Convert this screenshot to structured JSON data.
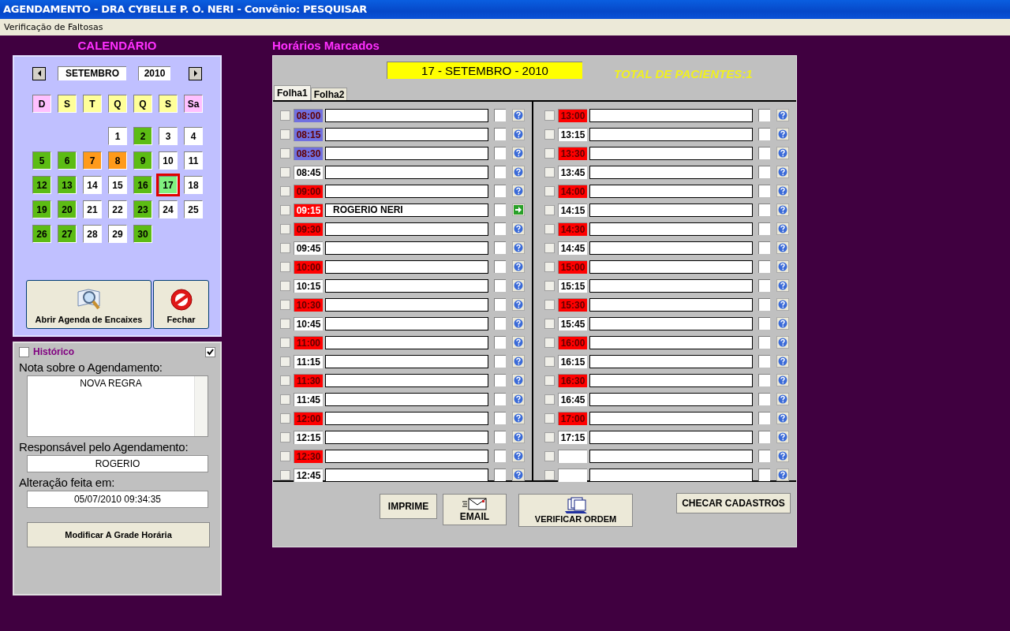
{
  "window": {
    "title": "AGENDAMENTO - DRA CYBELLE P. O. NERI - Convênio: PESQUISAR"
  },
  "menu": [
    "Verificação de Faltosas"
  ],
  "calendar": {
    "heading": "CALENDÁRIO",
    "month": "SETEMBRO",
    "year": "2010",
    "weekdays": [
      {
        "label": "D",
        "color": "#ffc0ff"
      },
      {
        "label": "S",
        "color": "#ffff99"
      },
      {
        "label": "T",
        "color": "#ffff99"
      },
      {
        "label": "Q",
        "color": "#ffff99"
      },
      {
        "label": "Q",
        "color": "#ffff99"
      },
      {
        "label": "S",
        "color": "#ffff99"
      },
      {
        "label": "Sa",
        "color": "#ffc0ff"
      }
    ],
    "weeks": [
      [
        {
          "kind": "blank"
        },
        {
          "kind": "blank"
        },
        {
          "kind": "blank"
        },
        {
          "day": "1",
          "color": "#ffffff",
          "selected": false
        },
        {
          "day": "2",
          "color": "#5cbc14",
          "selected": false
        },
        {
          "day": "3",
          "color": "#ffffff",
          "selected": false
        },
        {
          "day": "4",
          "color": "#ffffff",
          "selected": false
        }
      ],
      [
        {
          "day": "5",
          "color": "#5cbc14",
          "selected": false
        },
        {
          "day": "6",
          "color": "#5cbc14",
          "selected": false
        },
        {
          "day": "7",
          "color": "#ff9a1a",
          "selected": false
        },
        {
          "day": "8",
          "color": "#ff9a1a",
          "selected": false
        },
        {
          "day": "9",
          "color": "#5cbc14",
          "selected": false
        },
        {
          "day": "10",
          "color": "#ffffff",
          "selected": false
        },
        {
          "day": "11",
          "color": "#ffffff",
          "selected": false
        }
      ],
      [
        {
          "day": "12",
          "color": "#5cbc14",
          "selected": false
        },
        {
          "day": "13",
          "color": "#5cbc14",
          "selected": false
        },
        {
          "day": "14",
          "color": "#ffffff",
          "selected": false
        },
        {
          "day": "15",
          "color": "#ffffff",
          "selected": false
        },
        {
          "day": "16",
          "color": "#5cbc14",
          "selected": false
        },
        {
          "day": "17",
          "color": "#80f080",
          "selected": true
        },
        {
          "day": "18",
          "color": "#ffffff",
          "selected": false
        }
      ],
      [
        {
          "day": "19",
          "color": "#5cbc14",
          "selected": false
        },
        {
          "day": "20",
          "color": "#5cbc14",
          "selected": false
        },
        {
          "day": "21",
          "color": "#ffffff",
          "selected": false
        },
        {
          "day": "22",
          "color": "#ffffff",
          "selected": false
        },
        {
          "day": "23",
          "color": "#5cbc14",
          "selected": false
        },
        {
          "day": "24",
          "color": "#ffffff",
          "selected": false
        },
        {
          "day": "25",
          "color": "#ffffff",
          "selected": false
        }
      ],
      [
        {
          "day": "26",
          "color": "#5cbc14",
          "selected": false
        },
        {
          "day": "27",
          "color": "#5cbc14",
          "selected": false
        },
        {
          "day": "28",
          "color": "#ffffff",
          "selected": false
        },
        {
          "day": "29",
          "color": "#ffffff",
          "selected": false
        },
        {
          "day": "30",
          "color": "#5cbc14",
          "selected": false
        }
      ]
    ],
    "buttons": [
      {
        "label": "Abrir Agenda de Encaixes",
        "kind": "agenda"
      },
      {
        "label": "Fechar",
        "kind": "close"
      }
    ]
  },
  "history": {
    "label": "Histórico",
    "checked": false,
    "toggle_checked": true,
    "note_label": "Nota sobre o Agendamento:",
    "note": "NOVA REGRA",
    "responsible_label": "Responsável pelo Agendamento:",
    "responsible": "ROGERIO",
    "changed_label": "Alteração feita em:",
    "changed": "05/07/2010 09:34:35",
    "button": "Modificar A Grade Horária"
  },
  "schedule": {
    "heading": "Horários Marcados",
    "date": "17 - SETEMBRO - 2010",
    "total": "TOTAL DE PACIENTES:1",
    "tabs": [
      {
        "label": "Folha1",
        "selected": true
      },
      {
        "label": "Folha2",
        "selected": false
      }
    ],
    "columns": [
      [
        {
          "time": "08:00",
          "color": "#7070e0",
          "kind": "help",
          "checked": false,
          "confirmed": false
        },
        {
          "time": "08:15",
          "color": "#7070e0",
          "kind": "help",
          "checked": false,
          "confirmed": false
        },
        {
          "time": "08:30",
          "color": "#7070e0",
          "kind": "help",
          "checked": false,
          "confirmed": false
        },
        {
          "time": "08:45",
          "color": "#ffffff",
          "kind": "help",
          "checked": false,
          "confirmed": false
        },
        {
          "time": "09:00",
          "color": "#ff0000",
          "kind": "help",
          "checked": false,
          "confirmed": false
        },
        {
          "time": "09:15",
          "color": "#ff0000",
          "kind": "booked",
          "patient": "ROGERIO NERI",
          "checked": false,
          "confirmed": false
        },
        {
          "time": "09:30",
          "color": "#ff0000",
          "kind": "help",
          "checked": false,
          "confirmed": false
        },
        {
          "time": "09:45",
          "color": "#ffffff",
          "kind": "help",
          "checked": false,
          "confirmed": false
        },
        {
          "time": "10:00",
          "color": "#ff0000",
          "kind": "help",
          "checked": false,
          "confirmed": false
        },
        {
          "time": "10:15",
          "color": "#ffffff",
          "kind": "help",
          "checked": false,
          "confirmed": false
        },
        {
          "time": "10:30",
          "color": "#ff0000",
          "kind": "help",
          "checked": false,
          "confirmed": false
        },
        {
          "time": "10:45",
          "color": "#ffffff",
          "kind": "help",
          "checked": false,
          "confirmed": false
        },
        {
          "time": "11:00",
          "color": "#ff0000",
          "kind": "help",
          "checked": false,
          "confirmed": false
        },
        {
          "time": "11:15",
          "color": "#ffffff",
          "kind": "help",
          "checked": false,
          "confirmed": false
        },
        {
          "time": "11:30",
          "color": "#ff0000",
          "kind": "help",
          "checked": false,
          "confirmed": false
        },
        {
          "time": "11:45",
          "color": "#ffffff",
          "kind": "help",
          "checked": false,
          "confirmed": false
        },
        {
          "time": "12:00",
          "color": "#ff0000",
          "kind": "help",
          "checked": false,
          "confirmed": false
        },
        {
          "time": "12:15",
          "color": "#ffffff",
          "kind": "help",
          "checked": false,
          "confirmed": false
        },
        {
          "time": "12:30",
          "color": "#ff0000",
          "kind": "help",
          "checked": false,
          "confirmed": false
        },
        {
          "time": "12:45",
          "color": "#ffffff",
          "kind": "help",
          "checked": false,
          "confirmed": false
        }
      ],
      [
        {
          "time": "13:00",
          "color": "#ff0000",
          "kind": "help",
          "checked": false,
          "confirmed": false
        },
        {
          "time": "13:15",
          "color": "#ffffff",
          "kind": "help",
          "checked": false,
          "confirmed": false
        },
        {
          "time": "13:30",
          "color": "#ff0000",
          "kind": "help",
          "checked": false,
          "confirmed": false
        },
        {
          "time": "13:45",
          "color": "#ffffff",
          "kind": "help",
          "checked": false,
          "confirmed": false
        },
        {
          "time": "14:00",
          "color": "#ff0000",
          "kind": "help",
          "checked": false,
          "confirmed": false
        },
        {
          "time": "14:15",
          "color": "#ffffff",
          "kind": "help",
          "checked": false,
          "confirmed": false
        },
        {
          "time": "14:30",
          "color": "#ff0000",
          "kind": "help",
          "checked": false,
          "confirmed": false
        },
        {
          "time": "14:45",
          "color": "#ffffff",
          "kind": "help",
          "checked": false,
          "confirmed": false
        },
        {
          "time": "15:00",
          "color": "#ff0000",
          "kind": "help",
          "checked": false,
          "confirmed": false
        },
        {
          "time": "15:15",
          "color": "#ffffff",
          "kind": "help",
          "checked": false,
          "confirmed": false
        },
        {
          "time": "15:30",
          "color": "#ff0000",
          "kind": "help",
          "checked": false,
          "confirmed": false
        },
        {
          "time": "15:45",
          "color": "#ffffff",
          "kind": "help",
          "checked": false,
          "confirmed": false
        },
        {
          "time": "16:00",
          "color": "#ff0000",
          "kind": "help",
          "checked": false,
          "confirmed": false
        },
        {
          "time": "16:15",
          "color": "#ffffff",
          "kind": "help",
          "checked": false,
          "confirmed": false
        },
        {
          "time": "16:30",
          "color": "#ff0000",
          "kind": "help",
          "checked": false,
          "confirmed": false
        },
        {
          "time": "16:45",
          "color": "#ffffff",
          "kind": "help",
          "checked": false,
          "confirmed": false
        },
        {
          "time": "17:00",
          "color": "#ff0000",
          "kind": "help",
          "checked": false,
          "confirmed": false
        },
        {
          "time": "17:15",
          "color": "#ffffff",
          "kind": "help",
          "checked": false,
          "confirmed": false
        },
        {
          "color": "#ffffff",
          "kind": "help",
          "checked": false,
          "confirmed": false
        },
        {
          "color": "#ffffff",
          "kind": "help",
          "checked": false,
          "confirmed": false
        }
      ]
    ],
    "buttons": [
      {
        "label": "IMPRIME",
        "kind": "text"
      },
      {
        "label": "EMAIL",
        "kind": "email"
      },
      {
        "label": "VERIFICAR ORDEM",
        "kind": "stack"
      },
      {
        "label": "CHECAR CADASTROS",
        "kind": "text"
      }
    ]
  }
}
